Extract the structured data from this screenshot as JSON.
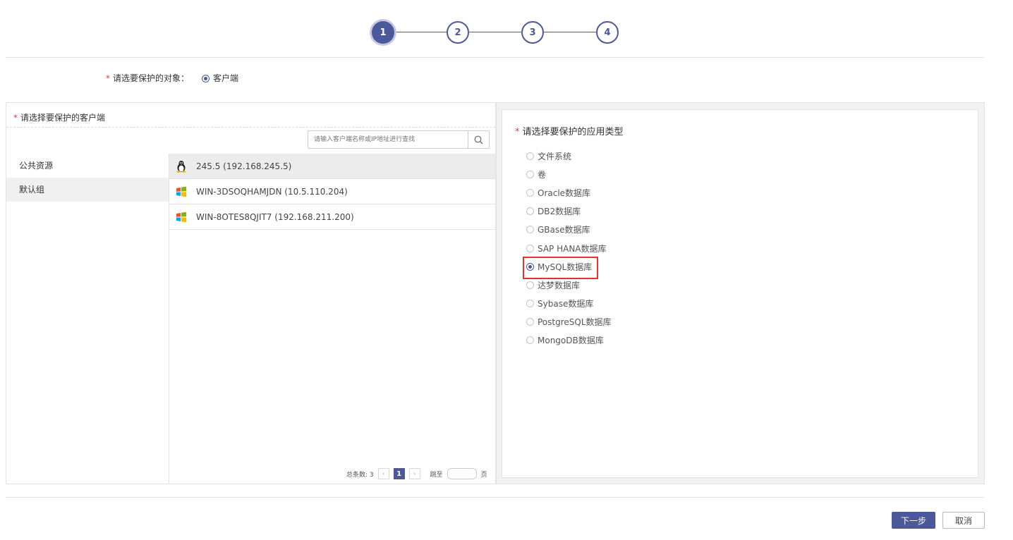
{
  "stepper": {
    "steps": [
      "1",
      "2",
      "3",
      "4"
    ],
    "current": 1
  },
  "target": {
    "label": "请选要保护的对象：",
    "option": "客户端"
  },
  "client_panel": {
    "title": "请选择要保护的客户端",
    "search_placeholder": "请输入客户端名称或IP地址进行查找",
    "groups": [
      "公共资源",
      "默认组"
    ],
    "selected_group": "默认组",
    "clients": [
      {
        "name": "245.5 (192.168.245.5)",
        "os": "linux-icon"
      },
      {
        "name": "WIN-3DSOQHAMJDN (10.5.110.204)",
        "os": "windows-icon"
      },
      {
        "name": "WIN-8OTES8QJIT7 (192.168.211.200)",
        "os": "windows-icon"
      }
    ],
    "selected_client": "245.5 (192.168.245.5)",
    "pagination": {
      "total_label": "总条数: 3",
      "current_page": "1",
      "jump_label": "跳至",
      "page_label": "页"
    }
  },
  "app_panel": {
    "title": "请选择要保护的应用类型",
    "types": [
      "文件系统",
      "卷",
      "Oracle数据库",
      "DB2数据库",
      "GBase数据库",
      "SAP HANA数据库",
      "MySQL数据库",
      "达梦数据库",
      "Sybase数据库",
      "PostgreSQL数据库",
      "MongoDB数据库"
    ],
    "selected": "MySQL数据库"
  },
  "footer": {
    "next_label": "下一步",
    "cancel_label": "取消"
  },
  "colors": {
    "accent": "#4b5899",
    "highlight": "#e8312b",
    "required": "#e4393c"
  }
}
